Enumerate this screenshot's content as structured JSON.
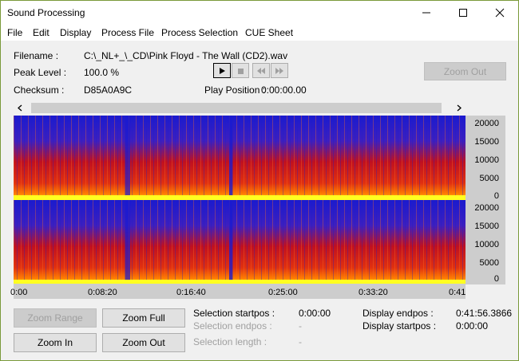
{
  "window": {
    "title": "Sound Processing"
  },
  "menu": [
    "File",
    "Edit",
    "Display",
    "Process File",
    "Process Selection",
    "CUE Sheet"
  ],
  "info": {
    "filename_label": "Filename :",
    "filename_value": "C:\\_NL+_\\_CD\\Pink Floyd - The Wall (CD2).wav",
    "peak_label": "Peak Level :",
    "peak_value": "100.0 %",
    "checksum_label": "Checksum :",
    "checksum_value": "D85A0A9C",
    "play_position_label": "Play Position :",
    "play_position_value": "0:00:00.00"
  },
  "transport": {
    "play": "play-icon",
    "stop": "stop-icon",
    "rewind": "rewind-icon",
    "forward": "fast-forward-icon"
  },
  "buttons": {
    "zoom_out_top": "Zoom Out",
    "zoom_range": "Zoom Range",
    "zoom_full": "Zoom Full",
    "zoom_in": "Zoom In",
    "zoom_out": "Zoom Out"
  },
  "freq_axis": [
    "20000",
    "15000",
    "10000",
    "5000",
    "0"
  ],
  "time_axis": [
    "0:00",
    "0:08:20",
    "0:16:40",
    "0:25:00",
    "0:33:20",
    "0:41"
  ],
  "selection": {
    "startpos_label": "Selection startpos :",
    "startpos_value": "0:00:00",
    "endpos_label": "Selection endpos :",
    "endpos_value": "-",
    "length_label": "Selection length :",
    "length_value": "-"
  },
  "display": {
    "endpos_label": "Display endpos :",
    "endpos_value": "0:41:56.3866",
    "startpos_label": "Display startpos :",
    "startpos_value": "0:00:00"
  },
  "colors": {
    "spectrogram_low": "#1a1ad0",
    "spectrogram_mid": "#d01010",
    "spectrogram_high": "#ffff00",
    "panel": "#cdcdcd"
  }
}
